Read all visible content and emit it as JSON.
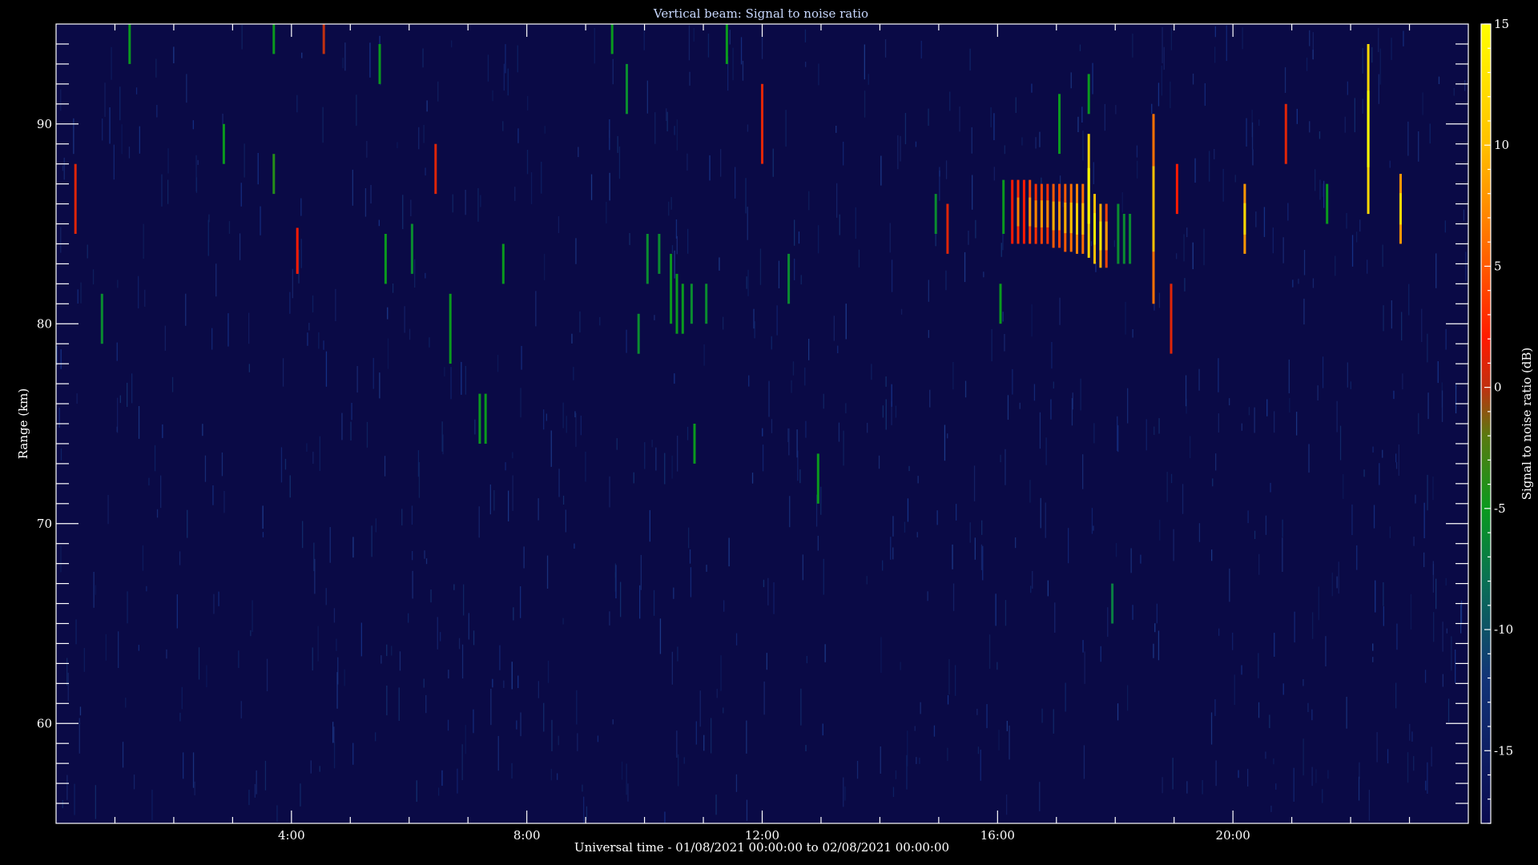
{
  "chart_data": {
    "type": "heatmap",
    "title": "Vertical beam: Signal to noise ratio",
    "xlabel": "Universal time - 01/08/2021 00:00:00 to 02/08/2021 00:00:00",
    "ylabel": "Range (km)",
    "colorbar_label": "Signal to noise ratio (dB)",
    "x_unit": "hours UT",
    "xlim": [
      0,
      24
    ],
    "ylim": [
      55,
      95
    ],
    "zlim": [
      -18,
      15
    ],
    "x_ticks": [
      {
        "value": 4,
        "label": "4:00"
      },
      {
        "value": 8,
        "label": "8:00"
      },
      {
        "value": 12,
        "label": "12:00"
      },
      {
        "value": 16,
        "label": "16:00"
      },
      {
        "value": 20,
        "label": "20:00"
      }
    ],
    "y_ticks": [
      {
        "value": 60,
        "label": "60"
      },
      {
        "value": 70,
        "label": "70"
      },
      {
        "value": 80,
        "label": "80"
      },
      {
        "value": 90,
        "label": "90"
      }
    ],
    "colorbar_ticks": [
      {
        "value": 15,
        "label": "15"
      },
      {
        "value": 10,
        "label": "10"
      },
      {
        "value": 5,
        "label": "5"
      },
      {
        "value": 0,
        "label": "0"
      },
      {
        "value": -5,
        "label": "-5"
      },
      {
        "value": -10,
        "label": "-10"
      },
      {
        "value": -15,
        "label": "-15"
      }
    ],
    "colorscale": [
      {
        "value": -18,
        "color": "#0a0a50"
      },
      {
        "value": -12,
        "color": "#123478"
      },
      {
        "value": -8,
        "color": "#0a7055"
      },
      {
        "value": -5,
        "color": "#0a9a1e"
      },
      {
        "value": -2,
        "color": "#5a7a10"
      },
      {
        "value": 0,
        "color": "#c03010"
      },
      {
        "value": 2,
        "color": "#ff1a00"
      },
      {
        "value": 6,
        "color": "#ff7000"
      },
      {
        "value": 10,
        "color": "#ffc000"
      },
      {
        "value": 15,
        "color": "#ffff00"
      }
    ],
    "background_snr_db": -16,
    "echoes": [
      {
        "t": 0.33,
        "r_min": 84.5,
        "r_max": 88.0,
        "snr": 1
      },
      {
        "t": 0.78,
        "r_min": 79.0,
        "r_max": 81.5,
        "snr": -6
      },
      {
        "t": 1.25,
        "r_min": 93.0,
        "r_max": 95.0,
        "snr": -5
      },
      {
        "t": 2.85,
        "r_min": 88.0,
        "r_max": 90.0,
        "snr": -5
      },
      {
        "t": 3.7,
        "r_min": 86.5,
        "r_max": 88.5,
        "snr": -4
      },
      {
        "t": 3.7,
        "r_min": 93.5,
        "r_max": 95.0,
        "snr": -5
      },
      {
        "t": 4.1,
        "r_min": 82.5,
        "r_max": 84.8,
        "snr": 2
      },
      {
        "t": 4.55,
        "r_min": 93.5,
        "r_max": 95.0,
        "snr": 0
      },
      {
        "t": 5.5,
        "r_min": 92.0,
        "r_max": 94.0,
        "snr": -5
      },
      {
        "t": 5.6,
        "r_min": 82.0,
        "r_max": 84.5,
        "snr": -5
      },
      {
        "t": 6.05,
        "r_min": 82.5,
        "r_max": 85.0,
        "snr": -6
      },
      {
        "t": 6.45,
        "r_min": 86.5,
        "r_max": 89.0,
        "snr": 1
      },
      {
        "t": 6.7,
        "r_min": 78.0,
        "r_max": 81.5,
        "snr": -5
      },
      {
        "t": 7.2,
        "r_min": 74.0,
        "r_max": 76.5,
        "snr": -5
      },
      {
        "t": 7.3,
        "r_min": 74.0,
        "r_max": 76.5,
        "snr": -5
      },
      {
        "t": 7.6,
        "r_min": 82.0,
        "r_max": 84.0,
        "snr": -5
      },
      {
        "t": 9.45,
        "r_min": 93.5,
        "r_max": 95.0,
        "snr": -5
      },
      {
        "t": 9.7,
        "r_min": 90.5,
        "r_max": 93.0,
        "snr": -6
      },
      {
        "t": 9.9,
        "r_min": 78.5,
        "r_max": 80.5,
        "snr": -6
      },
      {
        "t": 10.05,
        "r_min": 82.0,
        "r_max": 84.5,
        "snr": -6
      },
      {
        "t": 10.25,
        "r_min": 82.5,
        "r_max": 84.5,
        "snr": -6
      },
      {
        "t": 10.45,
        "r_min": 80.0,
        "r_max": 83.5,
        "snr": -5
      },
      {
        "t": 10.55,
        "r_min": 79.5,
        "r_max": 82.5,
        "snr": -5
      },
      {
        "t": 10.65,
        "r_min": 79.5,
        "r_max": 82.0,
        "snr": -5
      },
      {
        "t": 10.8,
        "r_min": 80.0,
        "r_max": 82.0,
        "snr": -6
      },
      {
        "t": 10.85,
        "r_min": 73.0,
        "r_max": 75.0,
        "snr": -5
      },
      {
        "t": 11.05,
        "r_min": 80.0,
        "r_max": 82.0,
        "snr": -6
      },
      {
        "t": 11.4,
        "r_min": 93.0,
        "r_max": 95.0,
        "snr": -5
      },
      {
        "t": 12.0,
        "r_min": 88.0,
        "r_max": 92.0,
        "snr": 1
      },
      {
        "t": 12.45,
        "r_min": 81.0,
        "r_max": 83.5,
        "snr": -6
      },
      {
        "t": 12.95,
        "r_min": 71.0,
        "r_max": 73.5,
        "snr": -5
      },
      {
        "t": 14.95,
        "r_min": 84.5,
        "r_max": 86.5,
        "snr": -6
      },
      {
        "t": 15.15,
        "r_min": 83.5,
        "r_max": 86.0,
        "snr": 1
      },
      {
        "t": 16.05,
        "r_min": 80.0,
        "r_max": 82.0,
        "snr": -5
      },
      {
        "t": 16.1,
        "r_min": 84.5,
        "r_max": 87.2,
        "snr": -5
      },
      {
        "t": 16.25,
        "r_min": 84.0,
        "r_max": 87.2,
        "snr": 2
      },
      {
        "t": 16.35,
        "r_min": 84.0,
        "r_max": 87.2,
        "snr": 3
      },
      {
        "t": 16.45,
        "r_min": 84.0,
        "r_max": 87.2,
        "snr": 2
      },
      {
        "t": 16.55,
        "r_min": 84.0,
        "r_max": 87.2,
        "snr": 4
      },
      {
        "t": 16.65,
        "r_min": 84.0,
        "r_max": 87.0,
        "snr": 3
      },
      {
        "t": 16.75,
        "r_min": 84.0,
        "r_max": 87.0,
        "snr": 4
      },
      {
        "t": 16.85,
        "r_min": 84.0,
        "r_max": 87.0,
        "snr": 3
      },
      {
        "t": 16.95,
        "r_min": 83.8,
        "r_max": 87.0,
        "snr": 5
      },
      {
        "t": 17.05,
        "r_min": 83.8,
        "r_max": 87.0,
        "snr": 4
      },
      {
        "t": 17.15,
        "r_min": 83.6,
        "r_max": 87.0,
        "snr": 5
      },
      {
        "t": 17.25,
        "r_min": 83.6,
        "r_max": 87.0,
        "snr": 6
      },
      {
        "t": 17.35,
        "r_min": 83.5,
        "r_max": 87.0,
        "snr": 7
      },
      {
        "t": 17.45,
        "r_min": 83.5,
        "r_max": 87.0,
        "snr": 6
      },
      {
        "t": 17.55,
        "r_min": 83.3,
        "r_max": 89.5,
        "snr": 12
      },
      {
        "t": 17.65,
        "r_min": 83.0,
        "r_max": 86.5,
        "snr": 10
      },
      {
        "t": 17.75,
        "r_min": 82.8,
        "r_max": 86.0,
        "snr": 9
      },
      {
        "t": 17.85,
        "r_min": 82.8,
        "r_max": 86.0,
        "snr": 4
      },
      {
        "t": 17.55,
        "r_min": 90.5,
        "r_max": 92.5,
        "snr": -5
      },
      {
        "t": 18.05,
        "r_min": 83.0,
        "r_max": 86.0,
        "snr": -6
      },
      {
        "t": 18.15,
        "r_min": 83.0,
        "r_max": 85.5,
        "snr": -6
      },
      {
        "t": 18.25,
        "r_min": 83.0,
        "r_max": 85.5,
        "snr": -6
      },
      {
        "t": 17.05,
        "r_min": 88.5,
        "r_max": 91.5,
        "snr": -5
      },
      {
        "t": 18.65,
        "r_min": 81.0,
        "r_max": 90.5,
        "snr": 6
      },
      {
        "t": 18.95,
        "r_min": 78.5,
        "r_max": 82.0,
        "snr": 1
      },
      {
        "t": 19.05,
        "r_min": 85.5,
        "r_max": 88.0,
        "snr": 2
      },
      {
        "t": 20.2,
        "r_min": 83.5,
        "r_max": 87.0,
        "snr": 8
      },
      {
        "t": 20.9,
        "r_min": 88.0,
        "r_max": 91.0,
        "snr": 1
      },
      {
        "t": 21.6,
        "r_min": 85.0,
        "r_max": 87.0,
        "snr": -5
      },
      {
        "t": 22.3,
        "r_min": 85.5,
        "r_max": 94.0,
        "snr": 12
      },
      {
        "t": 22.85,
        "r_min": 84.0,
        "r_max": 87.5,
        "snr": 8
      },
      {
        "t": 17.95,
        "r_min": 65.0,
        "r_max": 67.0,
        "snr": -7
      }
    ]
  }
}
